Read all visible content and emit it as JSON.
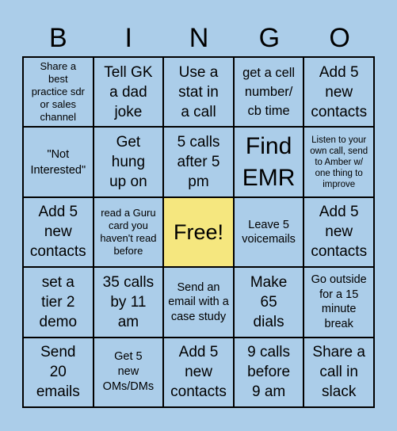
{
  "header": {
    "letters": [
      "B",
      "I",
      "N",
      "G",
      "O"
    ]
  },
  "colors": {
    "background": "#abcde9",
    "cell": "#abcde9",
    "free_cell": "#f5e77f",
    "grid_line": "#000000"
  },
  "board": {
    "rows": [
      [
        {
          "text": "Share a best practice sdr or sales channel"
        },
        {
          "text": "Tell GK a dad joke"
        },
        {
          "text": "Use a stat in a call"
        },
        {
          "text": "get a cell number/ cb time"
        },
        {
          "text": "Add 5 new contacts"
        }
      ],
      [
        {
          "text": "\"Not Interested\""
        },
        {
          "text": "Get hung up on"
        },
        {
          "text": "5 calls after 5 pm"
        },
        {
          "text": "Find EMR"
        },
        {
          "text": "Listen to your own call, send to Amber w/ one thing to improve"
        }
      ],
      [
        {
          "text": "Add 5 new contacts"
        },
        {
          "text": "read a Guru card you haven't read before"
        },
        {
          "text": "Free!"
        },
        {
          "text": "Leave 5 voicemails"
        },
        {
          "text": "Add 5 new contacts"
        }
      ],
      [
        {
          "text": "set a tier 2 demo"
        },
        {
          "text": "35 calls by 11 am"
        },
        {
          "text": "Send an email with a case study"
        },
        {
          "text": "Make 65 dials"
        },
        {
          "text": "Go outside for a 15 minute break"
        }
      ],
      [
        {
          "text": "Send 20 emails"
        },
        {
          "text": "Get 5 new OMs/DMs"
        },
        {
          "text": "Add 5 new contacts"
        },
        {
          "text": "9 calls before 9 am"
        },
        {
          "text": "Share a call in slack"
        }
      ]
    ]
  }
}
